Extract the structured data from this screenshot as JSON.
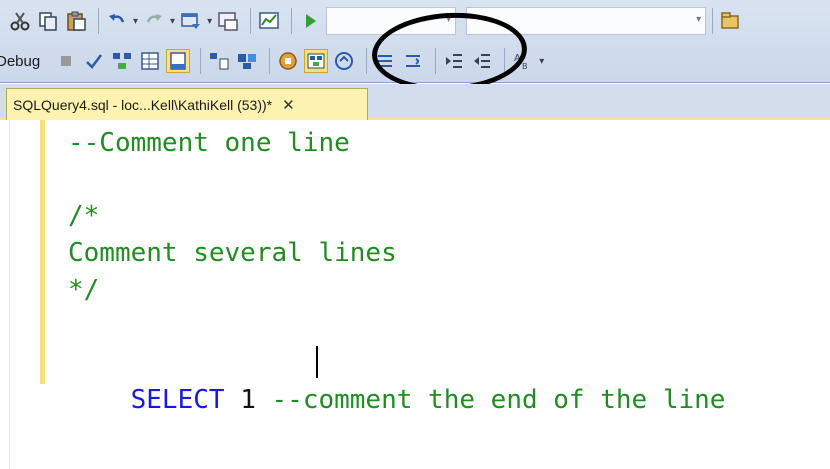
{
  "toolbar": {
    "debug_label": "Debug",
    "icons_row1": [
      "cut-icon",
      "copy-icon",
      "paste-icon",
      "undo-icon",
      "redo-icon",
      "new-window-icon",
      "activity-monitor-icon",
      "report-icon",
      "execute-icon"
    ],
    "icons_row2": [
      "stop-icon",
      "parse-icon",
      "estimated-plan-icon",
      "results-grid-icon",
      "results-file-icon",
      "query-options-icon",
      "include-plan-icon",
      "client-stats-icon",
      "comment-lines-icon",
      "uncomment-lines-icon",
      "decrease-indent-icon",
      "increase-indent-icon",
      "font-size-icon"
    ]
  },
  "tab": {
    "label": "SQLQuery4.sql - loc...Kell\\KathiKell (53))*",
    "close": "✕"
  },
  "editor": {
    "lines": [
      {
        "text": "--Comment one line"
      },
      {
        "text": "/*"
      },
      {
        "text": "Comment several lines"
      },
      {
        "text": "*/"
      },
      {
        "keyword": "SELECT",
        "number": "1",
        "comment": "--comment the end of the line"
      }
    ]
  },
  "colors": {
    "comment": "#238b23",
    "keyword": "#1a1ad6",
    "tab_active": "#fdf2b0",
    "annotation_circle": "#000000"
  }
}
